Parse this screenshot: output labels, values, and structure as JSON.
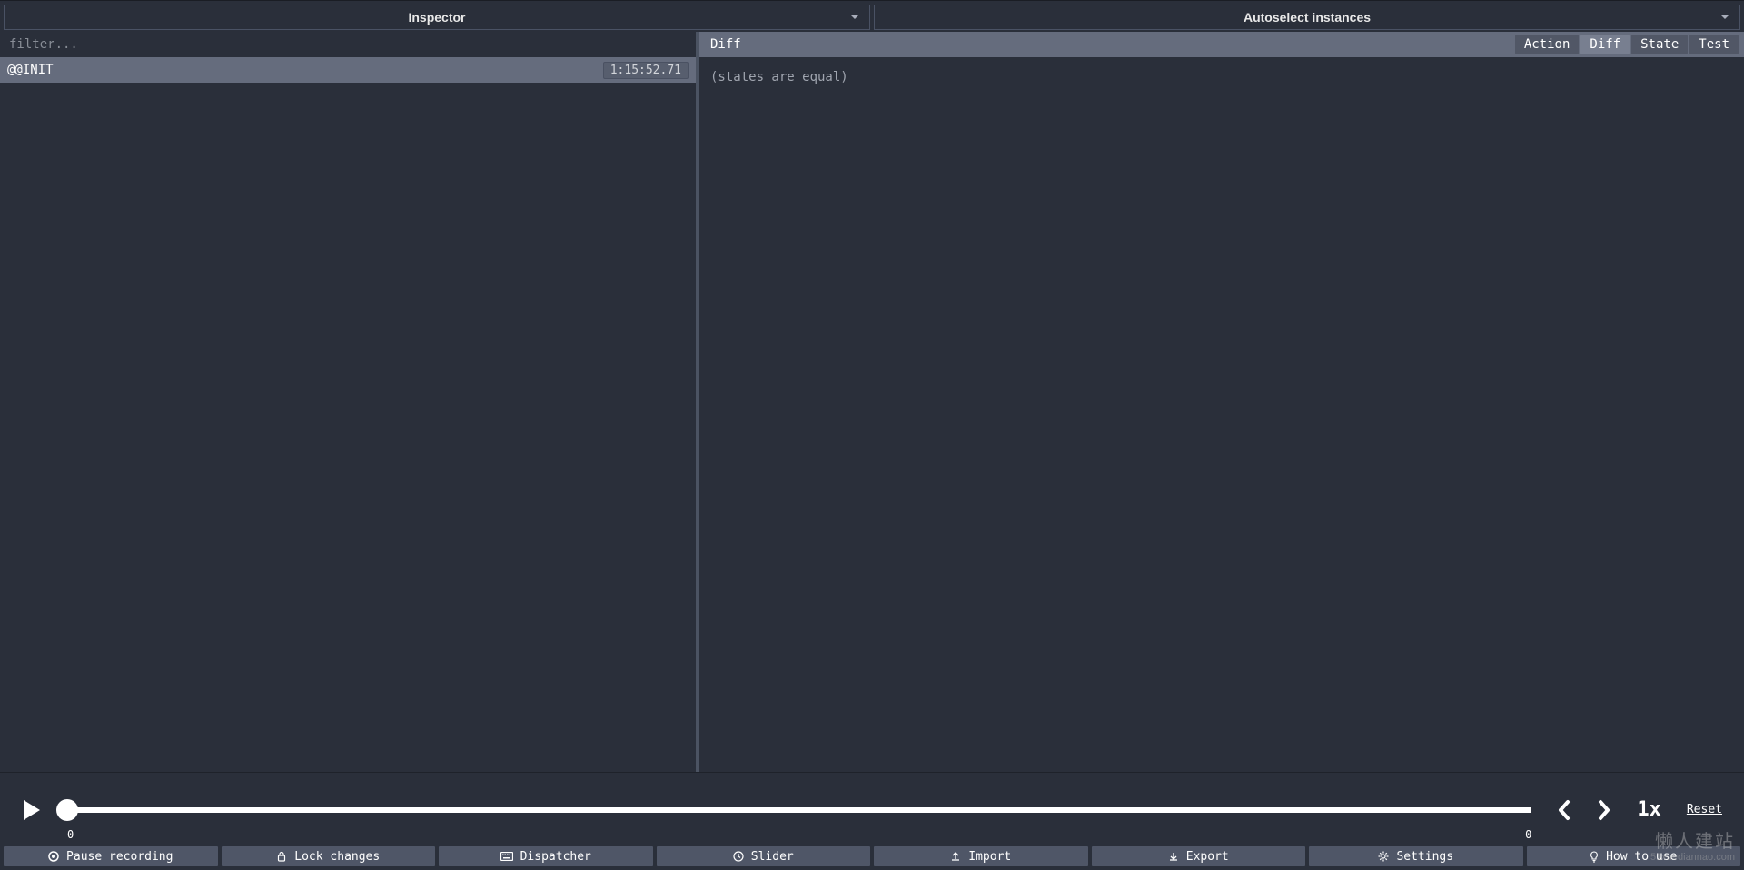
{
  "topTabs": {
    "left": "Inspector",
    "right": "Autoselect instances"
  },
  "leftPane": {
    "filterPlaceholder": "filter...",
    "actions": [
      {
        "name": "@@INIT",
        "timestamp": "1:15:52.71"
      }
    ]
  },
  "rightPane": {
    "headerTitle": "Diff",
    "views": {
      "action": "Action",
      "diff": "Diff",
      "state": "State",
      "test": "Test"
    },
    "activeView": "diff",
    "diffBody": "(states are equal)"
  },
  "playback": {
    "leftLabel": "0",
    "rightLabel": "0",
    "speed": "1x",
    "resetLabel": "Reset"
  },
  "bottomBar": {
    "pause": "Pause recording",
    "lock": "Lock changes",
    "dispatcher": "Dispatcher",
    "slider": "Slider",
    "import": "Import",
    "export": "Export",
    "settings": "Settings",
    "howto": "How to use"
  },
  "watermark": {
    "line1": "懒人建站",
    "line2": "51xuediannao.com"
  }
}
